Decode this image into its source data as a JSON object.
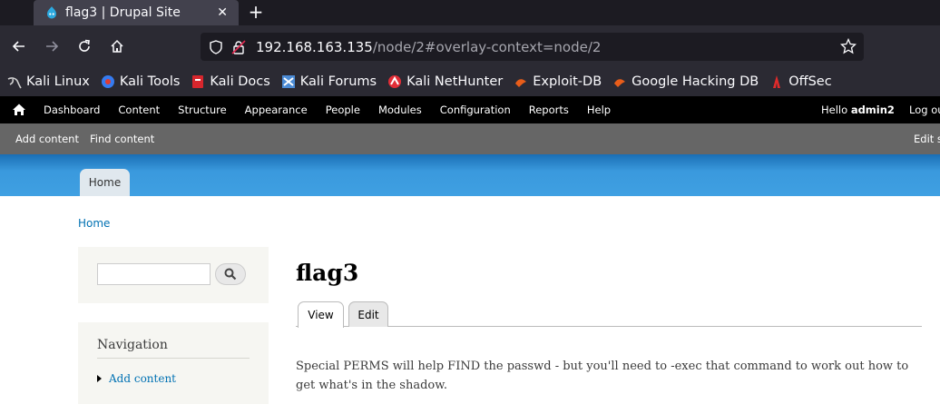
{
  "browser": {
    "tab_title": "flag3 | Drupal Site",
    "url_host": "192.168.163.135",
    "url_path": "/node/2#overlay-context=node/2",
    "bookmarks": [
      {
        "label": "Kali Linux",
        "icon": "kali-dragon-icon"
      },
      {
        "label": "Kali Tools",
        "icon": "kali-tools-icon"
      },
      {
        "label": "Kali Docs",
        "icon": "kali-docs-icon"
      },
      {
        "label": "Kali Forums",
        "icon": "kali-forums-icon"
      },
      {
        "label": "Kali NetHunter",
        "icon": "nethunter-icon"
      },
      {
        "label": "Exploit-DB",
        "icon": "exploitdb-icon"
      },
      {
        "label": "Google Hacking DB",
        "icon": "ghdb-icon"
      },
      {
        "label": "OffSec",
        "icon": "offsec-icon"
      }
    ]
  },
  "toolbar": {
    "menu": [
      "Dashboard",
      "Content",
      "Structure",
      "Appearance",
      "People",
      "Modules",
      "Configuration",
      "Reports",
      "Help"
    ],
    "hello_prefix": "Hello ",
    "username": "admin2",
    "logout": "Log ou"
  },
  "shortcuts": {
    "add_content": "Add content",
    "find_content": "Find content",
    "edit_shortcuts": "Edit s"
  },
  "header": {
    "home_tab": "Home"
  },
  "breadcrumb": "Home",
  "sidebar": {
    "search_value": "",
    "navigation_title": "Navigation",
    "navigation_items": [
      "Add content"
    ]
  },
  "main": {
    "title": "flag3",
    "tabs": [
      "View",
      "Edit"
    ],
    "body": "Special PERMS will help FIND the passwd - but you'll need to -exec that command to work out how to get what's in the shadow."
  },
  "colors": {
    "link": "#0071b3",
    "header_blue": "#3a99dd"
  }
}
